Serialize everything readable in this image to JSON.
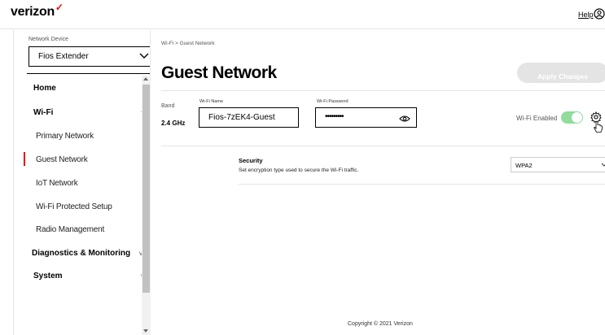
{
  "header": {
    "logo_text": "verizon",
    "logo_mark": "✓",
    "help_label": "Help",
    "user_icon": "user-icon"
  },
  "sidebar": {
    "device_label": "Network Device",
    "device_value": "Fios Extender",
    "sections": [
      {
        "label": "Home",
        "caret": ""
      },
      {
        "label": "Wi-Fi",
        "caret": "^"
      },
      {
        "label": "Diagnostics & Monitoring",
        "caret": "v"
      },
      {
        "label": "System",
        "caret": "v"
      }
    ],
    "wifi_items": [
      {
        "label": "Primary Network",
        "active": false
      },
      {
        "label": "Guest Network",
        "active": true
      },
      {
        "label": "IoT Network",
        "active": false
      },
      {
        "label": "Wi-Fi Protected Setup",
        "active": false
      },
      {
        "label": "Radio Management",
        "active": false
      }
    ]
  },
  "main": {
    "breadcrumb": "Wi-Fi  >  Guest Network",
    "title": "Guest Network",
    "apply_label": "Apply Changes",
    "band_label": "Band",
    "band_value": "2.4 GHz",
    "wifi_name_label": "Wi-Fi Name",
    "wifi_name_value": "Fios-7zEK4-Guest",
    "wifi_password_label": "Wi-Fi Password",
    "wifi_password_value": "•••••••••",
    "wifi_enabled_label": "Wi-Fi Enabled",
    "wifi_enabled": true,
    "security_title": "Security",
    "security_desc": "Set encryption type used to secure the Wi-Fi traffic.",
    "security_value": "WPA2"
  },
  "footer": {
    "copyright": "Copyright © 2021 Verizon"
  },
  "colors": {
    "brand_red": "#ee0000",
    "toggle_on": "#8fdc9b",
    "button_disabled": "#e4e4e4"
  }
}
